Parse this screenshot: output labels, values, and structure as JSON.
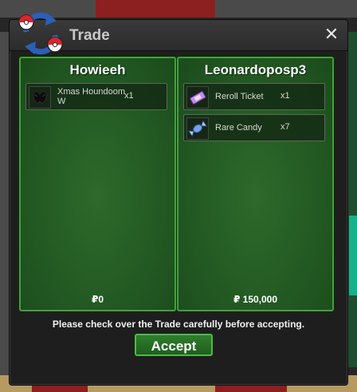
{
  "window": {
    "title": "Trade",
    "close_label": "✕"
  },
  "left_panel": {
    "player_name": "Howieeh",
    "items": [
      {
        "name": "Xmas Houndoom W",
        "qty": "x1",
        "icon": "houndoom-costume-icon"
      }
    ],
    "money": "₽0"
  },
  "right_panel": {
    "player_name": "Leonardoposp3",
    "items": [
      {
        "name": "Reroll Ticket",
        "qty": "x1",
        "icon": "ticket-icon"
      },
      {
        "name": "Rare Candy",
        "qty": "x7",
        "icon": "candy-icon"
      }
    ],
    "money": "₽ 150,000"
  },
  "notice": "Please check over the Trade carefully before accepting.",
  "accept_label": "Accept"
}
